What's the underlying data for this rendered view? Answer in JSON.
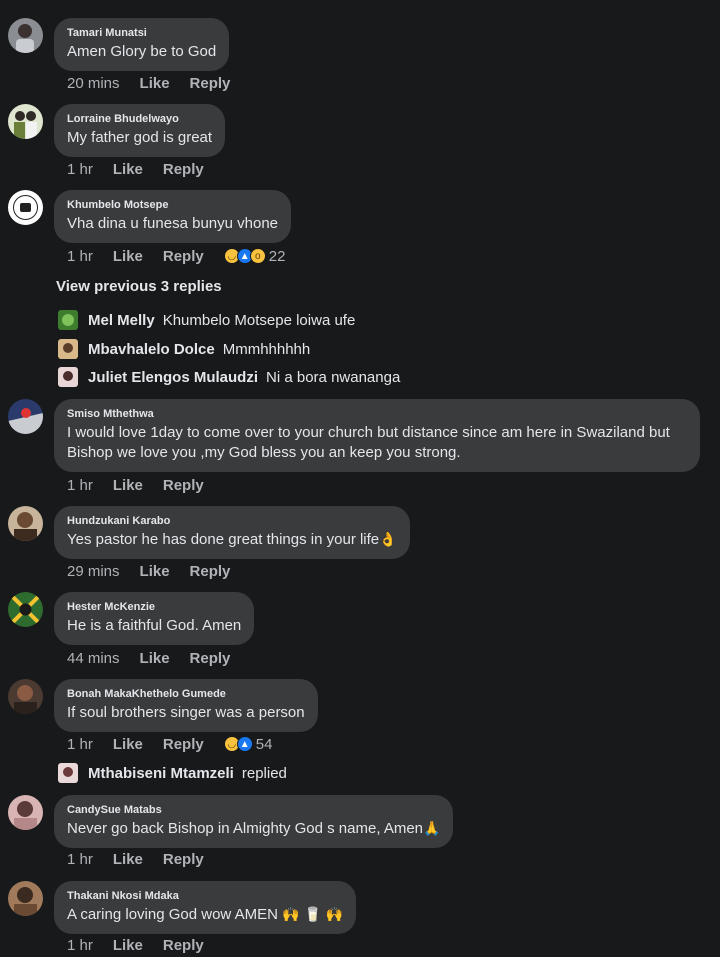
{
  "comments": [
    {
      "author": "Tamari Munatsi",
      "text": "Amen Glory be to God",
      "time": "20 mins",
      "like": "Like",
      "reply": "Reply"
    },
    {
      "author": "Lorraine Bhudelwayo",
      "text": "My father god is great",
      "time": "1 hr",
      "like": "Like",
      "reply": "Reply"
    },
    {
      "author": "Khumbelo Motsepe",
      "text": "Vha dina u funesa bunyu vhone",
      "time": "1 hr",
      "like": "Like",
      "reply": "Reply",
      "reaction_count": "22"
    },
    {
      "author": "Smiso Mthethwa",
      "text": "I would love 1day to come over to your church  but distance since am here in Swaziland  but Bishop we love you  ,my God bless you  an keep you strong.",
      "time": "1 hr",
      "like": "Like",
      "reply": "Reply"
    },
    {
      "author": "Hundzukani Karabo",
      "text": "Yes pastor he has done great things in your life",
      "emoji": "👌",
      "time": "29 mins",
      "like": "Like",
      "reply": "Reply"
    },
    {
      "author": "Hester McKenzie",
      "text": "He is a faithful God. Amen",
      "time": "44 mins",
      "like": "Like",
      "reply": "Reply"
    },
    {
      "author": "Bonah MakaKhethelo Gumede",
      "text": "If soul brothers singer was a person",
      "time": "1 hr",
      "like": "Like",
      "reply": "Reply",
      "reaction_count": "54"
    },
    {
      "author": "CandySue Matabs",
      "text": "Never go back Bishop in Almighty God s name, Amen",
      "emoji": "🙏",
      "time": "1 hr",
      "like": "Like",
      "reply": "Reply"
    },
    {
      "author": "Thakani Nkosi Mdaka",
      "text": "A caring loving God wow AMEN",
      "emoji": "🙌 🥛 🙌",
      "time": "1 hr",
      "like": "Like",
      "reply": "Reply"
    }
  ],
  "view_previous": "View previous 3 replies",
  "replies_khumbelo": [
    {
      "author": "Mel Melly",
      "text": "Khumbelo Motsepe loiwa ufe"
    },
    {
      "author": "Mbavhalelo Dolce",
      "text": "Mmmhhhhhh"
    },
    {
      "author": "Juliet Elengos Mulaudzi",
      "text": "Ni a  bora nwananga"
    }
  ],
  "reply_bonah": {
    "author": "Mthabiseni Mtamzeli",
    "text": "replied"
  },
  "colors": {
    "background": "#18191a",
    "bubble": "#3a3b3c",
    "text": "#e4e6eb",
    "muted": "#b0b3b8",
    "like_blue": "#1877f2",
    "haha_yellow": "#f7c33e"
  }
}
